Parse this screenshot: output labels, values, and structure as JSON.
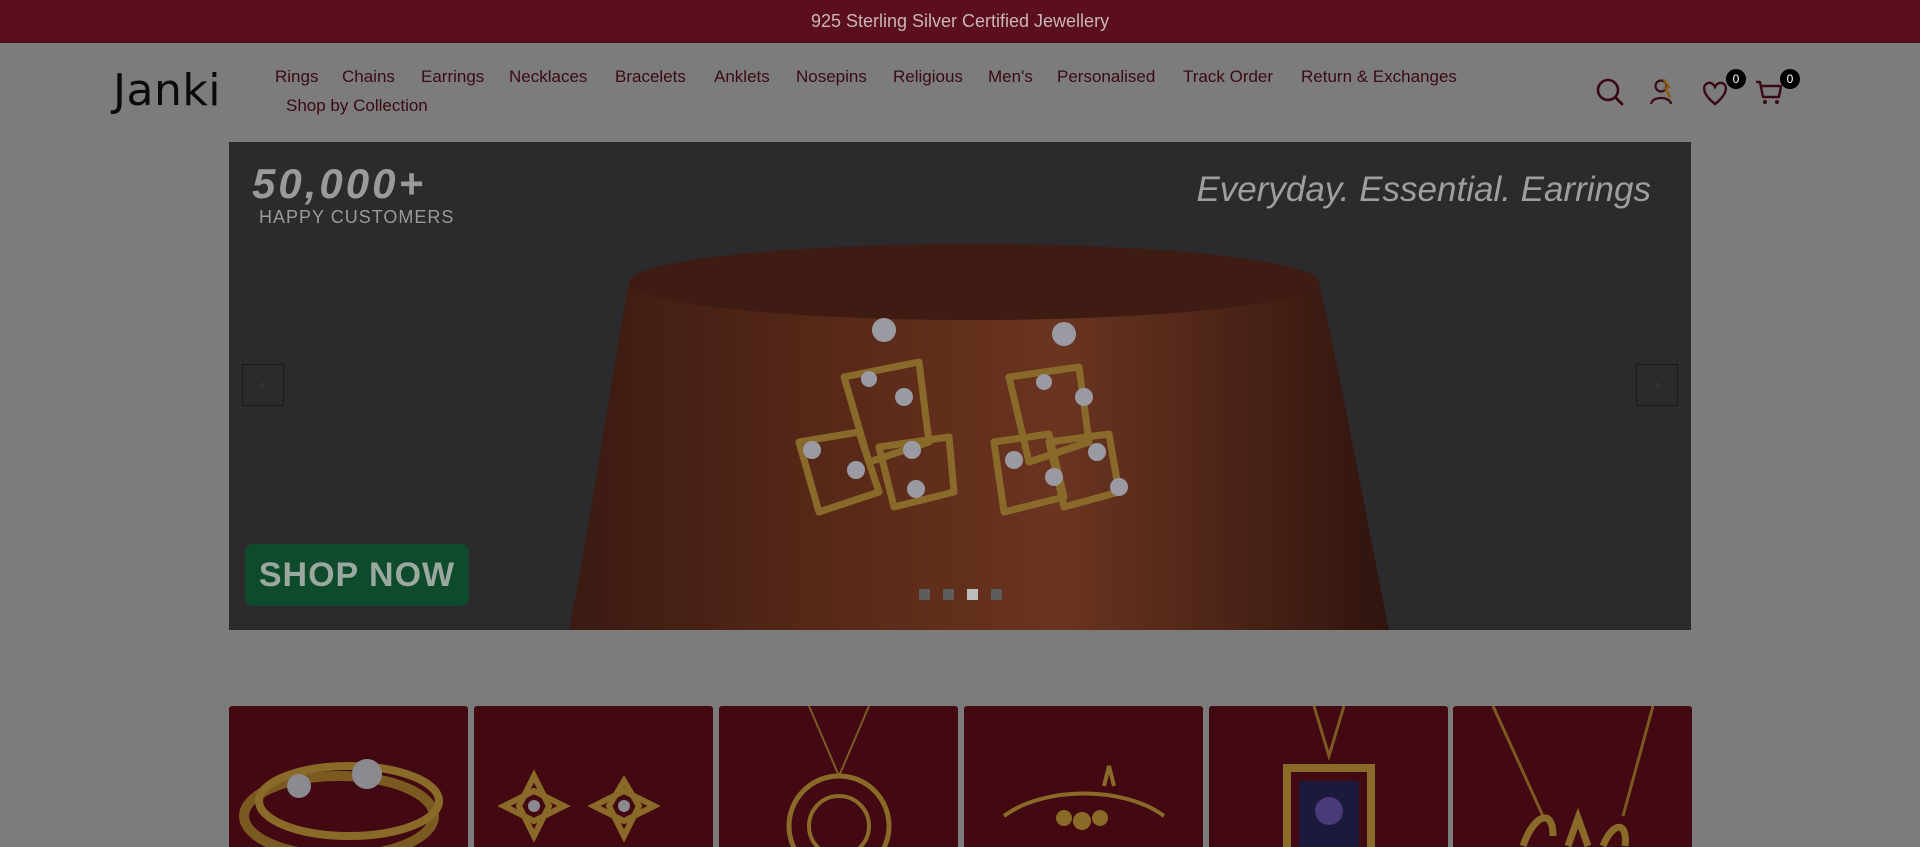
{
  "announcement": "925 Sterling Silver Certified Jewellery",
  "brand": {
    "logo_text": "Janki"
  },
  "nav": {
    "items": [
      {
        "label": "Rings"
      },
      {
        "label": "Chains"
      },
      {
        "label": "Earrings"
      },
      {
        "label": "Necklaces"
      },
      {
        "label": "Bracelets"
      },
      {
        "label": "Anklets"
      },
      {
        "label": "Nosepins"
      },
      {
        "label": "Religious"
      },
      {
        "label": "Men's"
      },
      {
        "label": "Personalised"
      },
      {
        "label": "Track Order"
      },
      {
        "label": "Return & Exchanges"
      },
      {
        "label": "Shop by Collection"
      }
    ]
  },
  "header_icons": {
    "search": "search-icon",
    "account": "user-icon",
    "wishlist": "heart-icon",
    "wishlist_count": "0",
    "cart": "cart-icon",
    "cart_count": "0"
  },
  "hero": {
    "stat_number": "50,000+",
    "stat_label": "HAPPY CUSTOMERS",
    "tagline": "Everyday. Essential. Earrings",
    "cta": "SHOP NOW",
    "prev_label": "‹",
    "next_label": "›",
    "slides_total": 4,
    "active_slide": 3
  },
  "categories": [
    {
      "icon": "ring-image"
    },
    {
      "icon": "earrings-image"
    },
    {
      "icon": "pendant-image"
    },
    {
      "icon": "bracelet-image"
    },
    {
      "icon": "religious-pendant-image"
    },
    {
      "icon": "name-necklace-image"
    }
  ],
  "colors": {
    "brand_maroon": "#5a0e1e",
    "overlay_gray": "#7c7c7c",
    "cta_green": "#0e4a2c",
    "category_bg": "#430912"
  }
}
